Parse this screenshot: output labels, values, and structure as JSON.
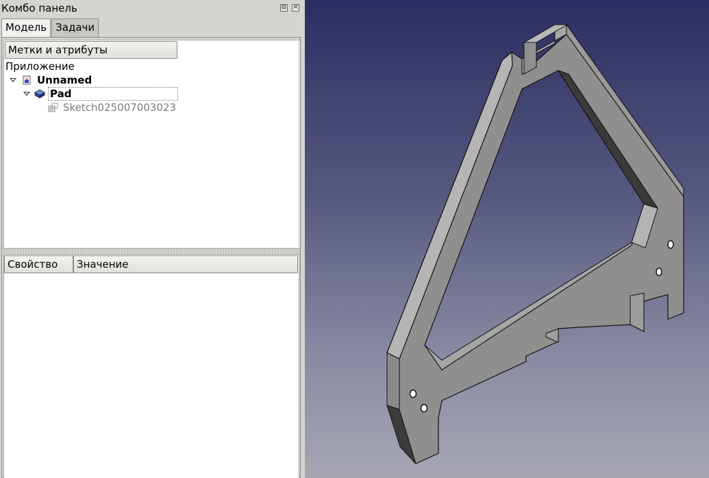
{
  "combo": {
    "title": "Комбо панель",
    "float_icon": "float-icon",
    "close_icon": "close-icon"
  },
  "tabs": [
    {
      "label": "Модель",
      "active": true
    },
    {
      "label": "Задачи",
      "active": false
    }
  ],
  "tree": {
    "header": "Метки и атрибуты",
    "root_label": "Приложение",
    "items": [
      {
        "label": "Unnamed",
        "icon": "document-icon",
        "expanded": true
      },
      {
        "label": "Pad",
        "icon": "pad-icon",
        "expanded": true
      },
      {
        "label": "Sketch025007003023",
        "icon": "sketch-icon"
      }
    ]
  },
  "properties": {
    "col_property": "Свойство",
    "col_value": "Значение"
  },
  "colors": {
    "view_top": "#2c2d62",
    "view_bottom": "#a6a6b3",
    "part_face": "#8c8c8c",
    "part_side_light": "#b0b0b0",
    "part_side_dark": "#4a4a4a"
  }
}
